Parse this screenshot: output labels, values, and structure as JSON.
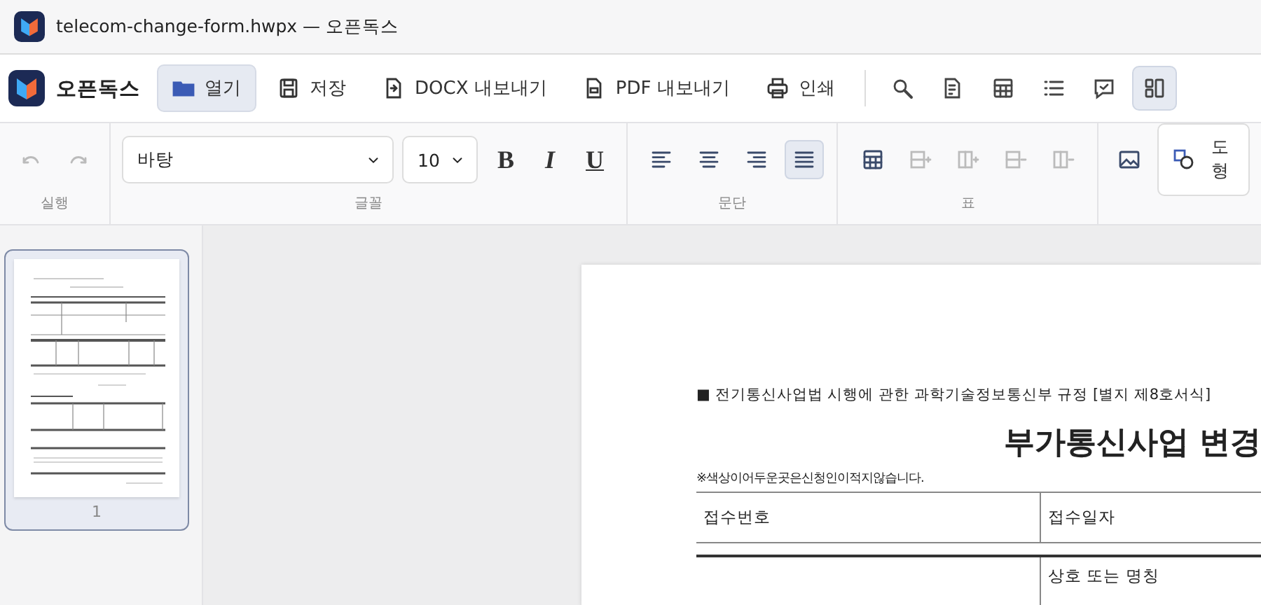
{
  "window": {
    "title": "telecom-change-form.hwpx — 오픈독스"
  },
  "toolbar": {
    "app_name": "오픈독스",
    "buttons": [
      {
        "kind": "open",
        "label": "열기",
        "selected": true
      },
      {
        "kind": "save",
        "label": "저장",
        "selected": false
      },
      {
        "kind": "docx",
        "label": "DOCX 내보내기",
        "selected": false
      },
      {
        "kind": "pdf",
        "label": "PDF 내보내기",
        "selected": false
      },
      {
        "kind": "print",
        "label": "인쇄",
        "selected": false
      }
    ],
    "icon_buttons": [
      {
        "kind": "search",
        "selected": false
      },
      {
        "kind": "document",
        "selected": false
      },
      {
        "kind": "table",
        "selected": false
      },
      {
        "kind": "list",
        "selected": false
      },
      {
        "kind": "comment",
        "selected": false
      },
      {
        "kind": "layout",
        "selected": true
      }
    ]
  },
  "ribbon": {
    "history": {
      "label": "실행",
      "tools": [
        {
          "kind": "undo",
          "disabled": true
        },
        {
          "kind": "redo",
          "disabled": true
        }
      ]
    },
    "font": {
      "label": "글꼴",
      "family": "바탕",
      "size": "10",
      "styles": [
        {
          "kind": "bold",
          "label": "B"
        },
        {
          "kind": "italic",
          "label": "I"
        },
        {
          "kind": "underline",
          "label": "U"
        }
      ]
    },
    "paragraph": {
      "label": "문단",
      "aligns": [
        {
          "kind": "left",
          "selected": false
        },
        {
          "kind": "center",
          "selected": false
        },
        {
          "kind": "right",
          "selected": false
        },
        {
          "kind": "justify",
          "selected": true
        }
      ]
    },
    "table": {
      "label": "표",
      "tools": [
        {
          "kind": "table",
          "disabled": false
        },
        {
          "kind": "add-row",
          "disabled": true
        },
        {
          "kind": "add-column",
          "disabled": true
        },
        {
          "kind": "delete-row",
          "disabled": true
        },
        {
          "kind": "delete-column",
          "disabled": true
        }
      ]
    },
    "insert": {
      "shape_label": "도형"
    }
  },
  "pages": [
    {
      "number": "1",
      "selected": true
    }
  ],
  "document": {
    "header": "■ 전기통신사업법 시행에 관한 과학기술정보통신부 규정 [별지 제8호서식]",
    "title": "부가통신사업 변경",
    "note": "※색상이어두운곳은신청인이적지않습니다.",
    "rows": [
      {
        "cells": [
          "접수번호",
          "접수일자"
        ]
      },
      {
        "cells": [
          "",
          "상호 또는 명칭"
        ]
      }
    ]
  }
}
